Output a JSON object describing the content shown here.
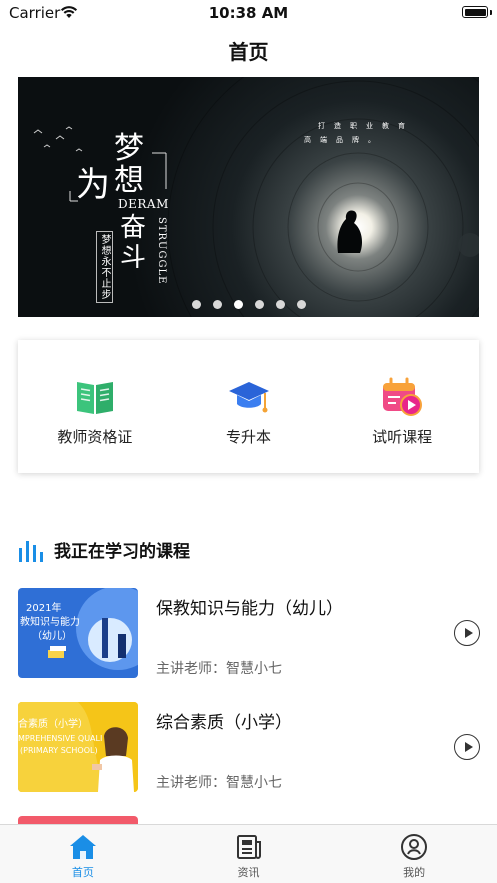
{
  "status_bar": {
    "carrier": "Carrier",
    "time": "10:38 AM",
    "battery_level": 1.0
  },
  "nav": {
    "title": "首页"
  },
  "banner": {
    "headline_wei": "为",
    "headline_mengxiang": "梦想",
    "headline_deram": "DERAM",
    "headline_fendou": "奋斗",
    "headline_struggle": "STRUGGLE",
    "vertical_text": "梦想永不止步",
    "small_line_1": "打造职业教育",
    "small_line_2": "高端品牌。",
    "page_count": 6,
    "active_page": 2
  },
  "quick_menu": [
    {
      "label": "教师资格证",
      "icon": "book-icon"
    },
    {
      "label": "专升本",
      "icon": "graduation-cap-icon"
    },
    {
      "label": "试听课程",
      "icon": "video-calendar-icon"
    }
  ],
  "section": {
    "title": "我正在学习的课程",
    "icon": "bar-chart-icon"
  },
  "courses": [
    {
      "title": "保教知识与能力（幼儿）",
      "teacher": "主讲老师：智慧小七",
      "thumb_line_1": "2021年",
      "thumb_line_2": "教知识与能力",
      "thumb_line_3": "（幼儿）",
      "thumb_color": "#2f6fd6"
    },
    {
      "title": "综合素质（小学）",
      "teacher": "主讲老师：智慧小七",
      "thumb_line_1": "合素质（小学）",
      "thumb_line_2": "MPREHENSIVE QUALI",
      "thumb_line_3": "(PRIMARY SCHOOL)",
      "thumb_color": "#f5c518"
    }
  ],
  "tab_bar": [
    {
      "label": "首页",
      "icon": "home-icon",
      "active": true
    },
    {
      "label": "资讯",
      "icon": "news-icon",
      "active": false
    },
    {
      "label": "我的",
      "icon": "profile-icon",
      "active": false
    }
  ],
  "colors": {
    "accent": "#1a8ee6",
    "book_green": "#3cc47c",
    "cap_blue": "#2a64d8",
    "calendar_pink": "#f04a86"
  }
}
